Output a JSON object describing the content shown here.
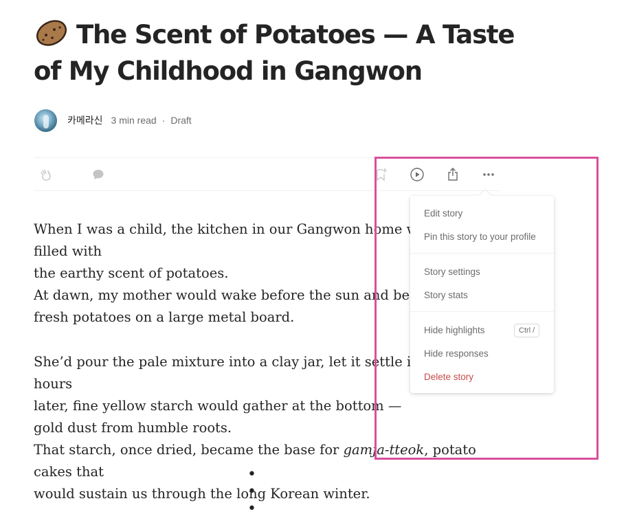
{
  "article": {
    "title": "The Scent of Potatoes — A Taste of My Childhood in Gangwon",
    "title_icon": "potato-emoji",
    "author": "카메라신",
    "read_time": "3 min read",
    "status": "Draft",
    "paragraph1": [
      "When I was a child, the kitchen in our Gangwon home was always filled with",
      "the earthy scent of potatoes.",
      "At dawn, my mother would wake before the sun and begin to grate",
      "fresh potatoes on a large metal board."
    ],
    "paragraph2": {
      "line1": "She’d pour the pale mixture into a clay jar, let it settle in water, and hours",
      "line2": "later, fine yellow starch would gather at the bottom —",
      "line3": "gold dust from humble roots.",
      "line4_before": "That starch, once dried, became the base for ",
      "line4_italic": "gamja-tteok",
      "line4_after": ", potato cakes that",
      "line5": "would sustain us through the long Korean winter."
    },
    "separator": "• • •"
  },
  "action_bar": {
    "icons": [
      "clap-icon",
      "comment-icon",
      "bookmark-icon",
      "play-icon",
      "share-icon",
      "more-icon"
    ]
  },
  "menu": {
    "edit_story": "Edit story",
    "pin_story": "Pin this story to your profile",
    "story_settings": "Story settings",
    "story_stats": "Story stats",
    "hide_highlights": "Hide highlights",
    "hide_highlights_shortcut": "Ctrl /",
    "hide_responses": "Hide responses",
    "delete_story": "Delete story"
  },
  "colors": {
    "text": "#242424",
    "muted": "#6b6b6b",
    "danger": "#c94a4a",
    "highlight_box": "#d94f9c"
  }
}
